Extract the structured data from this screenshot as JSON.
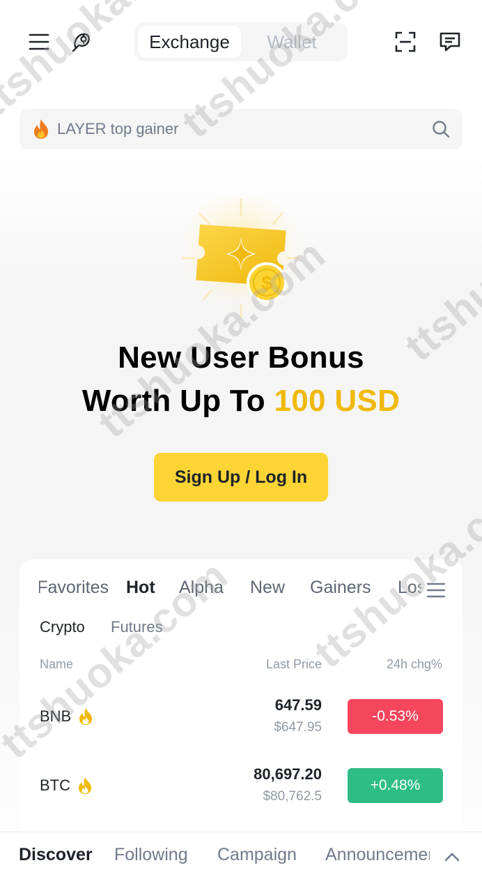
{
  "header": {
    "segments": [
      "Exchange",
      "Wallet"
    ],
    "active_segment": "Exchange"
  },
  "search": {
    "placeholder": "LAYER top gainer"
  },
  "hero": {
    "line1": "New User Bonus",
    "line2_prefix": "Worth Up To ",
    "line2_accent": "100 USD",
    "cta": "Sign Up / Log In"
  },
  "markets": {
    "tabs": [
      "Favorites",
      "Hot",
      "Alpha",
      "New",
      "Gainers",
      "Losers"
    ],
    "active_tab": "Hot",
    "subtabs": [
      "Crypto",
      "Futures"
    ],
    "active_subtab": "Crypto",
    "columns": {
      "name": "Name",
      "price": "Last Price",
      "change": "24h chg%"
    },
    "rows": [
      {
        "symbol": "BNB",
        "price": "647.59",
        "fiat": "$647.95",
        "change": "-0.53%",
        "direction": "down"
      },
      {
        "symbol": "BTC",
        "price": "80,697.20",
        "fiat": "$80,762.5",
        "change": "+0.48%",
        "direction": "up"
      }
    ]
  },
  "bottom_tabs": [
    "Discover",
    "Following",
    "Campaign",
    "Announcements"
  ],
  "active_bottom_tab": "Discover",
  "watermark": "ttshuoka.com",
  "colors": {
    "brand_yellow": "#fcd535",
    "accent_gold": "#f0b90b",
    "down_red": "#f6465d",
    "up_green": "#2ebd85"
  },
  "icons": [
    "menu-icon",
    "headset-icon",
    "scan-icon",
    "chat-icon",
    "flame-icon",
    "search-icon",
    "list-icon",
    "chevron-up-icon",
    "ticket-coin-icon"
  ]
}
